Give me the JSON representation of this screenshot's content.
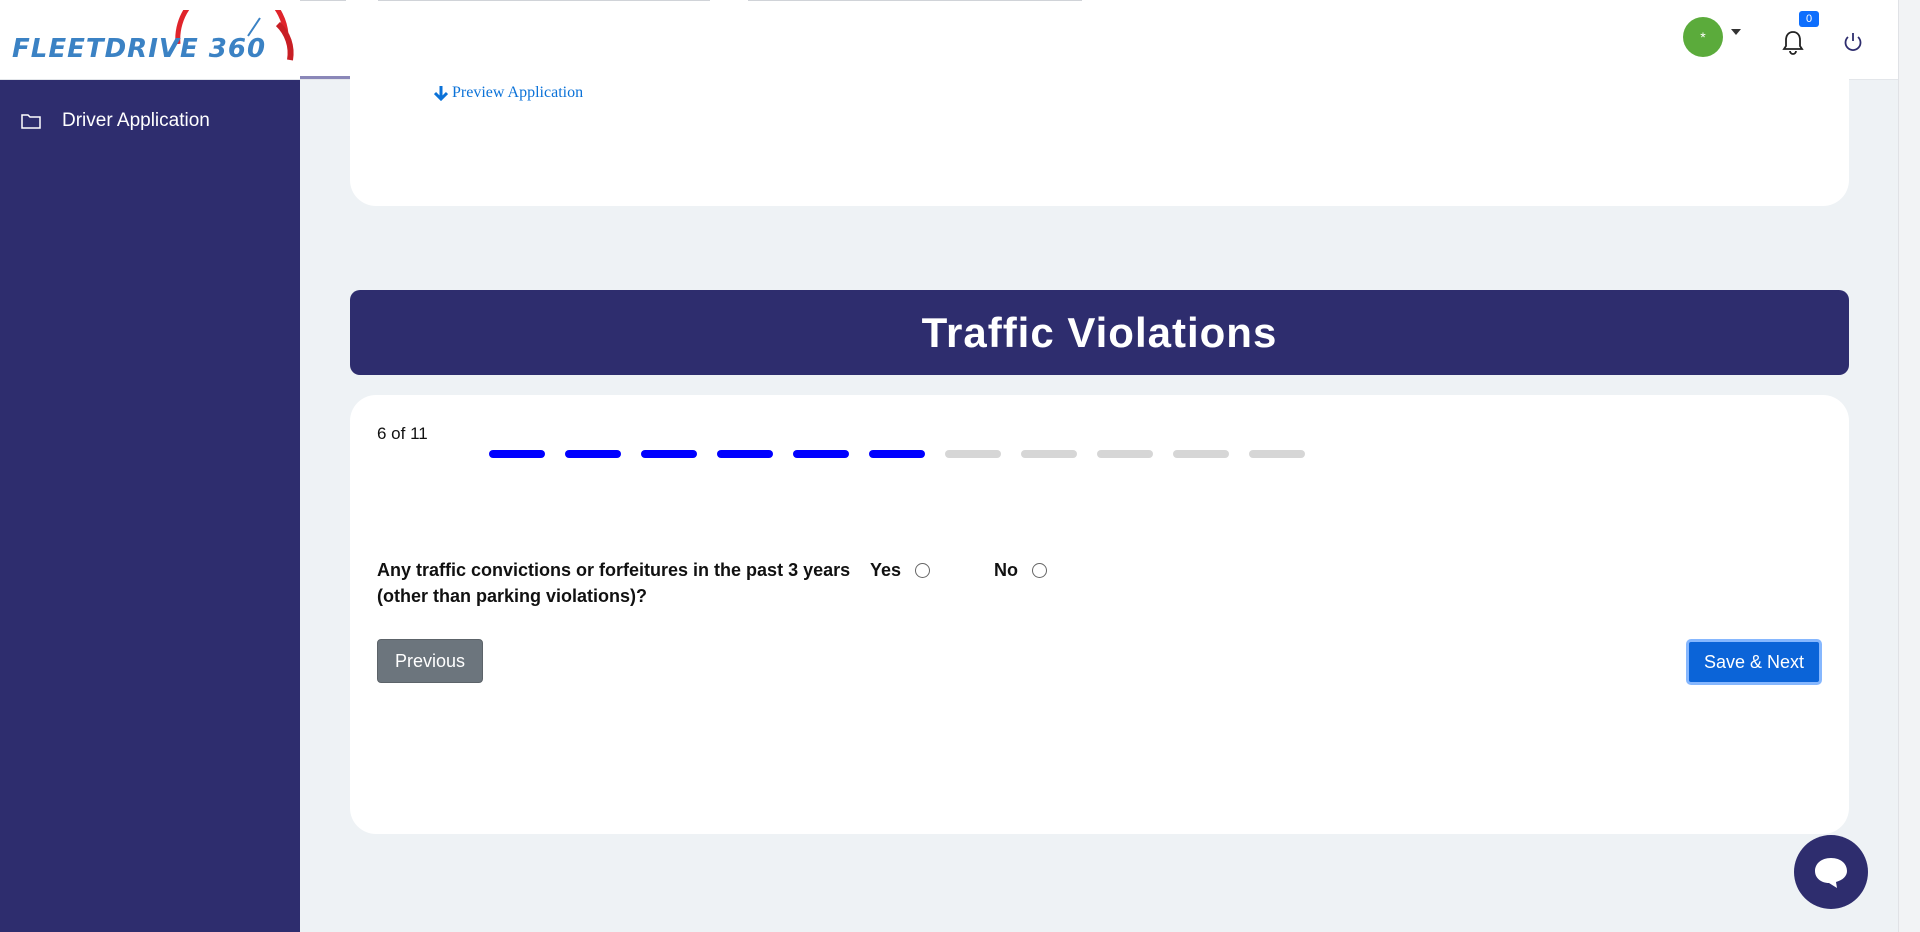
{
  "app": {
    "logo_text": "FLEETDRIVE 360"
  },
  "header": {
    "avatar_glyph": "*",
    "notifications_count": "0",
    "icons": [
      "user-avatar",
      "chevron-down-icon",
      "bell-icon",
      "power-icon"
    ]
  },
  "sidebar": {
    "items": [
      {
        "label": "Driver Application",
        "icon": "folder-icon"
      }
    ]
  },
  "preview": {
    "link_label": "Preview Application",
    "icon": "arrow-down-icon"
  },
  "section": {
    "title": "Traffic Violations"
  },
  "progress": {
    "label": "6 of 11",
    "current": 6,
    "total": 11,
    "active_color": "#0000ff",
    "inactive_color": "#d6d6d6"
  },
  "question": {
    "text": "Any traffic convictions or forfeitures in the past 3 years (other than parking violations)?",
    "options": [
      {
        "label": "Yes",
        "selected": false
      },
      {
        "label": "No",
        "selected": false
      }
    ]
  },
  "actions": {
    "previous_label": "Previous",
    "save_next_label": "Save & Next"
  },
  "colors": {
    "primary_navy": "#2e2d6e",
    "accent_blue": "#0b64d8",
    "secondary_gray": "#6c757d",
    "avatar_green": "#5bab3b"
  }
}
